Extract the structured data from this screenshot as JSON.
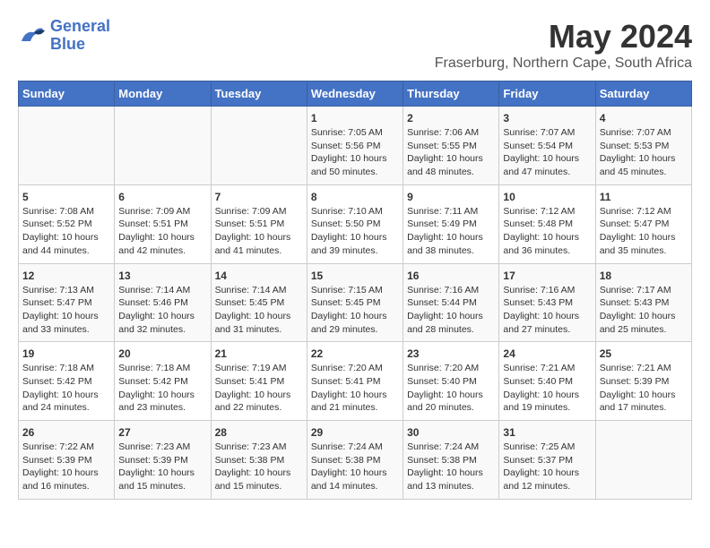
{
  "logo": {
    "line1": "General",
    "line2": "Blue"
  },
  "title": "May 2024",
  "subtitle": "Fraserburg, Northern Cape, South Africa",
  "days_of_week": [
    "Sunday",
    "Monday",
    "Tuesday",
    "Wednesday",
    "Thursday",
    "Friday",
    "Saturday"
  ],
  "weeks": [
    [
      {
        "num": "",
        "info": ""
      },
      {
        "num": "",
        "info": ""
      },
      {
        "num": "",
        "info": ""
      },
      {
        "num": "1",
        "info": "Sunrise: 7:05 AM\nSunset: 5:56 PM\nDaylight: 10 hours\nand 50 minutes."
      },
      {
        "num": "2",
        "info": "Sunrise: 7:06 AM\nSunset: 5:55 PM\nDaylight: 10 hours\nand 48 minutes."
      },
      {
        "num": "3",
        "info": "Sunrise: 7:07 AM\nSunset: 5:54 PM\nDaylight: 10 hours\nand 47 minutes."
      },
      {
        "num": "4",
        "info": "Sunrise: 7:07 AM\nSunset: 5:53 PM\nDaylight: 10 hours\nand 45 minutes."
      }
    ],
    [
      {
        "num": "5",
        "info": "Sunrise: 7:08 AM\nSunset: 5:52 PM\nDaylight: 10 hours\nand 44 minutes."
      },
      {
        "num": "6",
        "info": "Sunrise: 7:09 AM\nSunset: 5:51 PM\nDaylight: 10 hours\nand 42 minutes."
      },
      {
        "num": "7",
        "info": "Sunrise: 7:09 AM\nSunset: 5:51 PM\nDaylight: 10 hours\nand 41 minutes."
      },
      {
        "num": "8",
        "info": "Sunrise: 7:10 AM\nSunset: 5:50 PM\nDaylight: 10 hours\nand 39 minutes."
      },
      {
        "num": "9",
        "info": "Sunrise: 7:11 AM\nSunset: 5:49 PM\nDaylight: 10 hours\nand 38 minutes."
      },
      {
        "num": "10",
        "info": "Sunrise: 7:12 AM\nSunset: 5:48 PM\nDaylight: 10 hours\nand 36 minutes."
      },
      {
        "num": "11",
        "info": "Sunrise: 7:12 AM\nSunset: 5:47 PM\nDaylight: 10 hours\nand 35 minutes."
      }
    ],
    [
      {
        "num": "12",
        "info": "Sunrise: 7:13 AM\nSunset: 5:47 PM\nDaylight: 10 hours\nand 33 minutes."
      },
      {
        "num": "13",
        "info": "Sunrise: 7:14 AM\nSunset: 5:46 PM\nDaylight: 10 hours\nand 32 minutes."
      },
      {
        "num": "14",
        "info": "Sunrise: 7:14 AM\nSunset: 5:45 PM\nDaylight: 10 hours\nand 31 minutes."
      },
      {
        "num": "15",
        "info": "Sunrise: 7:15 AM\nSunset: 5:45 PM\nDaylight: 10 hours\nand 29 minutes."
      },
      {
        "num": "16",
        "info": "Sunrise: 7:16 AM\nSunset: 5:44 PM\nDaylight: 10 hours\nand 28 minutes."
      },
      {
        "num": "17",
        "info": "Sunrise: 7:16 AM\nSunset: 5:43 PM\nDaylight: 10 hours\nand 27 minutes."
      },
      {
        "num": "18",
        "info": "Sunrise: 7:17 AM\nSunset: 5:43 PM\nDaylight: 10 hours\nand 25 minutes."
      }
    ],
    [
      {
        "num": "19",
        "info": "Sunrise: 7:18 AM\nSunset: 5:42 PM\nDaylight: 10 hours\nand 24 minutes."
      },
      {
        "num": "20",
        "info": "Sunrise: 7:18 AM\nSunset: 5:42 PM\nDaylight: 10 hours\nand 23 minutes."
      },
      {
        "num": "21",
        "info": "Sunrise: 7:19 AM\nSunset: 5:41 PM\nDaylight: 10 hours\nand 22 minutes."
      },
      {
        "num": "22",
        "info": "Sunrise: 7:20 AM\nSunset: 5:41 PM\nDaylight: 10 hours\nand 21 minutes."
      },
      {
        "num": "23",
        "info": "Sunrise: 7:20 AM\nSunset: 5:40 PM\nDaylight: 10 hours\nand 20 minutes."
      },
      {
        "num": "24",
        "info": "Sunrise: 7:21 AM\nSunset: 5:40 PM\nDaylight: 10 hours\nand 19 minutes."
      },
      {
        "num": "25",
        "info": "Sunrise: 7:21 AM\nSunset: 5:39 PM\nDaylight: 10 hours\nand 17 minutes."
      }
    ],
    [
      {
        "num": "26",
        "info": "Sunrise: 7:22 AM\nSunset: 5:39 PM\nDaylight: 10 hours\nand 16 minutes."
      },
      {
        "num": "27",
        "info": "Sunrise: 7:23 AM\nSunset: 5:39 PM\nDaylight: 10 hours\nand 15 minutes."
      },
      {
        "num": "28",
        "info": "Sunrise: 7:23 AM\nSunset: 5:38 PM\nDaylight: 10 hours\nand 15 minutes."
      },
      {
        "num": "29",
        "info": "Sunrise: 7:24 AM\nSunset: 5:38 PM\nDaylight: 10 hours\nand 14 minutes."
      },
      {
        "num": "30",
        "info": "Sunrise: 7:24 AM\nSunset: 5:38 PM\nDaylight: 10 hours\nand 13 minutes."
      },
      {
        "num": "31",
        "info": "Sunrise: 7:25 AM\nSunset: 5:37 PM\nDaylight: 10 hours\nand 12 minutes."
      },
      {
        "num": "",
        "info": ""
      }
    ]
  ]
}
